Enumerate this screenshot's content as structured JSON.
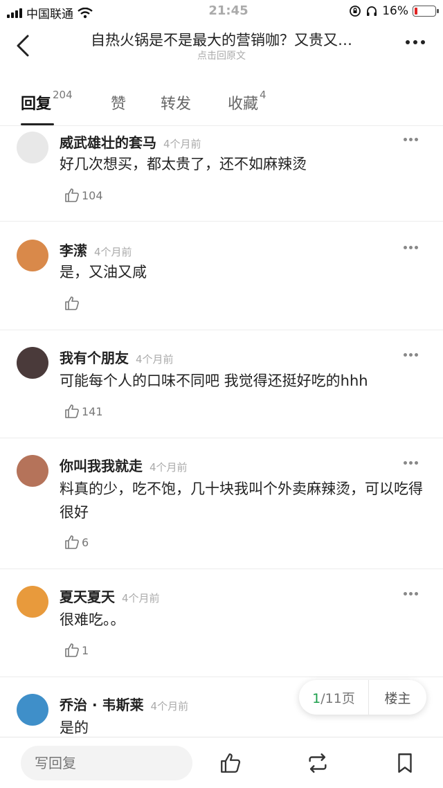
{
  "status_bar": {
    "carrier": "中国联通",
    "time": "21:45",
    "battery": "16%",
    "battery_level": 0.16
  },
  "header": {
    "title": "自热火锅是不是最大的营销咖？又贵又…",
    "subtitle": "点击回原文"
  },
  "tabs": [
    {
      "label": "回复",
      "count": "204"
    },
    {
      "label": "赞",
      "count": ""
    },
    {
      "label": "转发",
      "count": ""
    },
    {
      "label": "收藏",
      "count": "4"
    }
  ],
  "comments": [
    {
      "name": "威武雄壮的套马",
      "time": "4个月前",
      "text": "好几次想买，都太贵了，还不如麻辣烫",
      "likes": "104",
      "avatar_color": "#e8e8e8"
    },
    {
      "name": "李潆",
      "time": "4个月前",
      "text": "是，又油又咸",
      "likes": "",
      "avatar_color": "#d9894a"
    },
    {
      "name": "我有个朋友",
      "time": "4个月前",
      "text": "可能每个人的口味不同吧 我觉得还挺好吃的hhh",
      "likes": "141",
      "avatar_color": "#4a3a3a"
    },
    {
      "name": "你叫我我就走",
      "time": "4个月前",
      "text": "料真的少，吃不饱，几十块我叫个外卖麻辣烫，可以吃得很好",
      "likes": "6",
      "avatar_color": "#b5735a"
    },
    {
      "name": "夏天夏天",
      "time": "4个月前",
      "text": "很难吃。。",
      "likes": "1",
      "avatar_color": "#e89a3c"
    },
    {
      "name": "乔治 · 韦斯莱",
      "time": "4个月前",
      "text": "是的",
      "likes": "",
      "avatar_color": "#3f8fc9"
    }
  ],
  "pager": {
    "current": "1",
    "total_text": "/11页",
    "op_label": "楼主"
  },
  "bottom_bar": {
    "reply_placeholder": "写回复"
  },
  "colors": {
    "accent": "#1a9e4a",
    "battery_low": "#e02424"
  },
  "icons": [
    "signal-icon",
    "wifi-icon",
    "back-icon",
    "more-icon",
    "like-icon",
    "repost-icon",
    "bookmark-icon"
  ]
}
